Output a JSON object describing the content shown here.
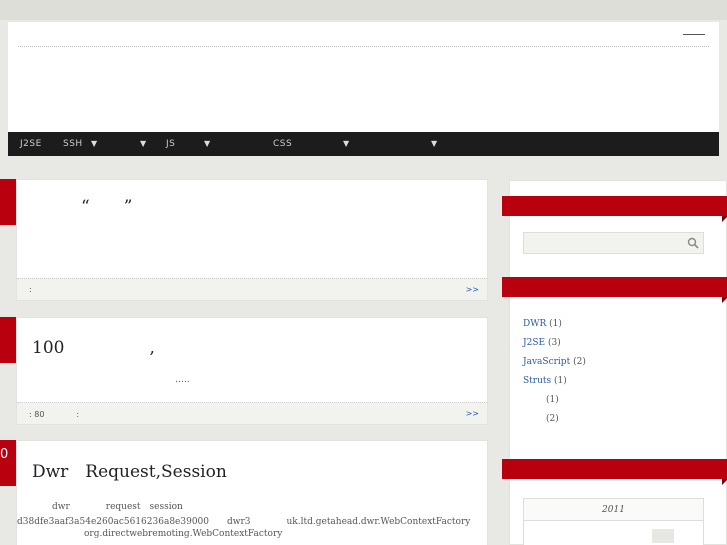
{
  "nav": {
    "items": [
      {
        "label": "J2SE",
        "has_dropdown": false
      },
      {
        "label": "SSH",
        "has_dropdown": true
      },
      {
        "label": "",
        "has_dropdown": true
      },
      {
        "label": "JS",
        "has_dropdown": true
      },
      {
        "label": "CSS",
        "has_dropdown": true
      },
      {
        "label": "",
        "has_dropdown": true
      }
    ],
    "arrow": "▼"
  },
  "posts": [
    {
      "flag": "",
      "title": "“　　”",
      "excerpt": "",
      "meta": ":",
      "more": ">>"
    },
    {
      "flag": "",
      "title": "100　　　　　,",
      "excerpt": "…..",
      "meta": ": 80　　　　:",
      "more": ">>"
    },
    {
      "flag": "0",
      "title": "Dwr　Request,Session",
      "excerpt_lines": [
        "dwr　　　　request　session",
        "d38dfe3aaf3a54e260ac5616236a8e39000　　dwr3　　　　uk.ltd.getahead.dwr.WebContextFactory",
        "org.directwebremoting.WebContextFactory"
      ]
    }
  ],
  "sidebar": {
    "search": {
      "placeholder": ""
    },
    "categories": [
      {
        "name": "DWR",
        "count": "(1)"
      },
      {
        "name": "J2SE",
        "count": "(3)"
      },
      {
        "name": "JavaScript",
        "count": "(2)"
      },
      {
        "name": "Struts",
        "count": "(1)"
      },
      {
        "name": "",
        "count": "(1)"
      },
      {
        "name": "",
        "count": "(2)"
      }
    ],
    "calendar": {
      "year": "2011"
    }
  },
  "colors": {
    "accent": "#b8000e",
    "nav_bg": "#1c1c1c",
    "link": "#2a5aa8"
  }
}
